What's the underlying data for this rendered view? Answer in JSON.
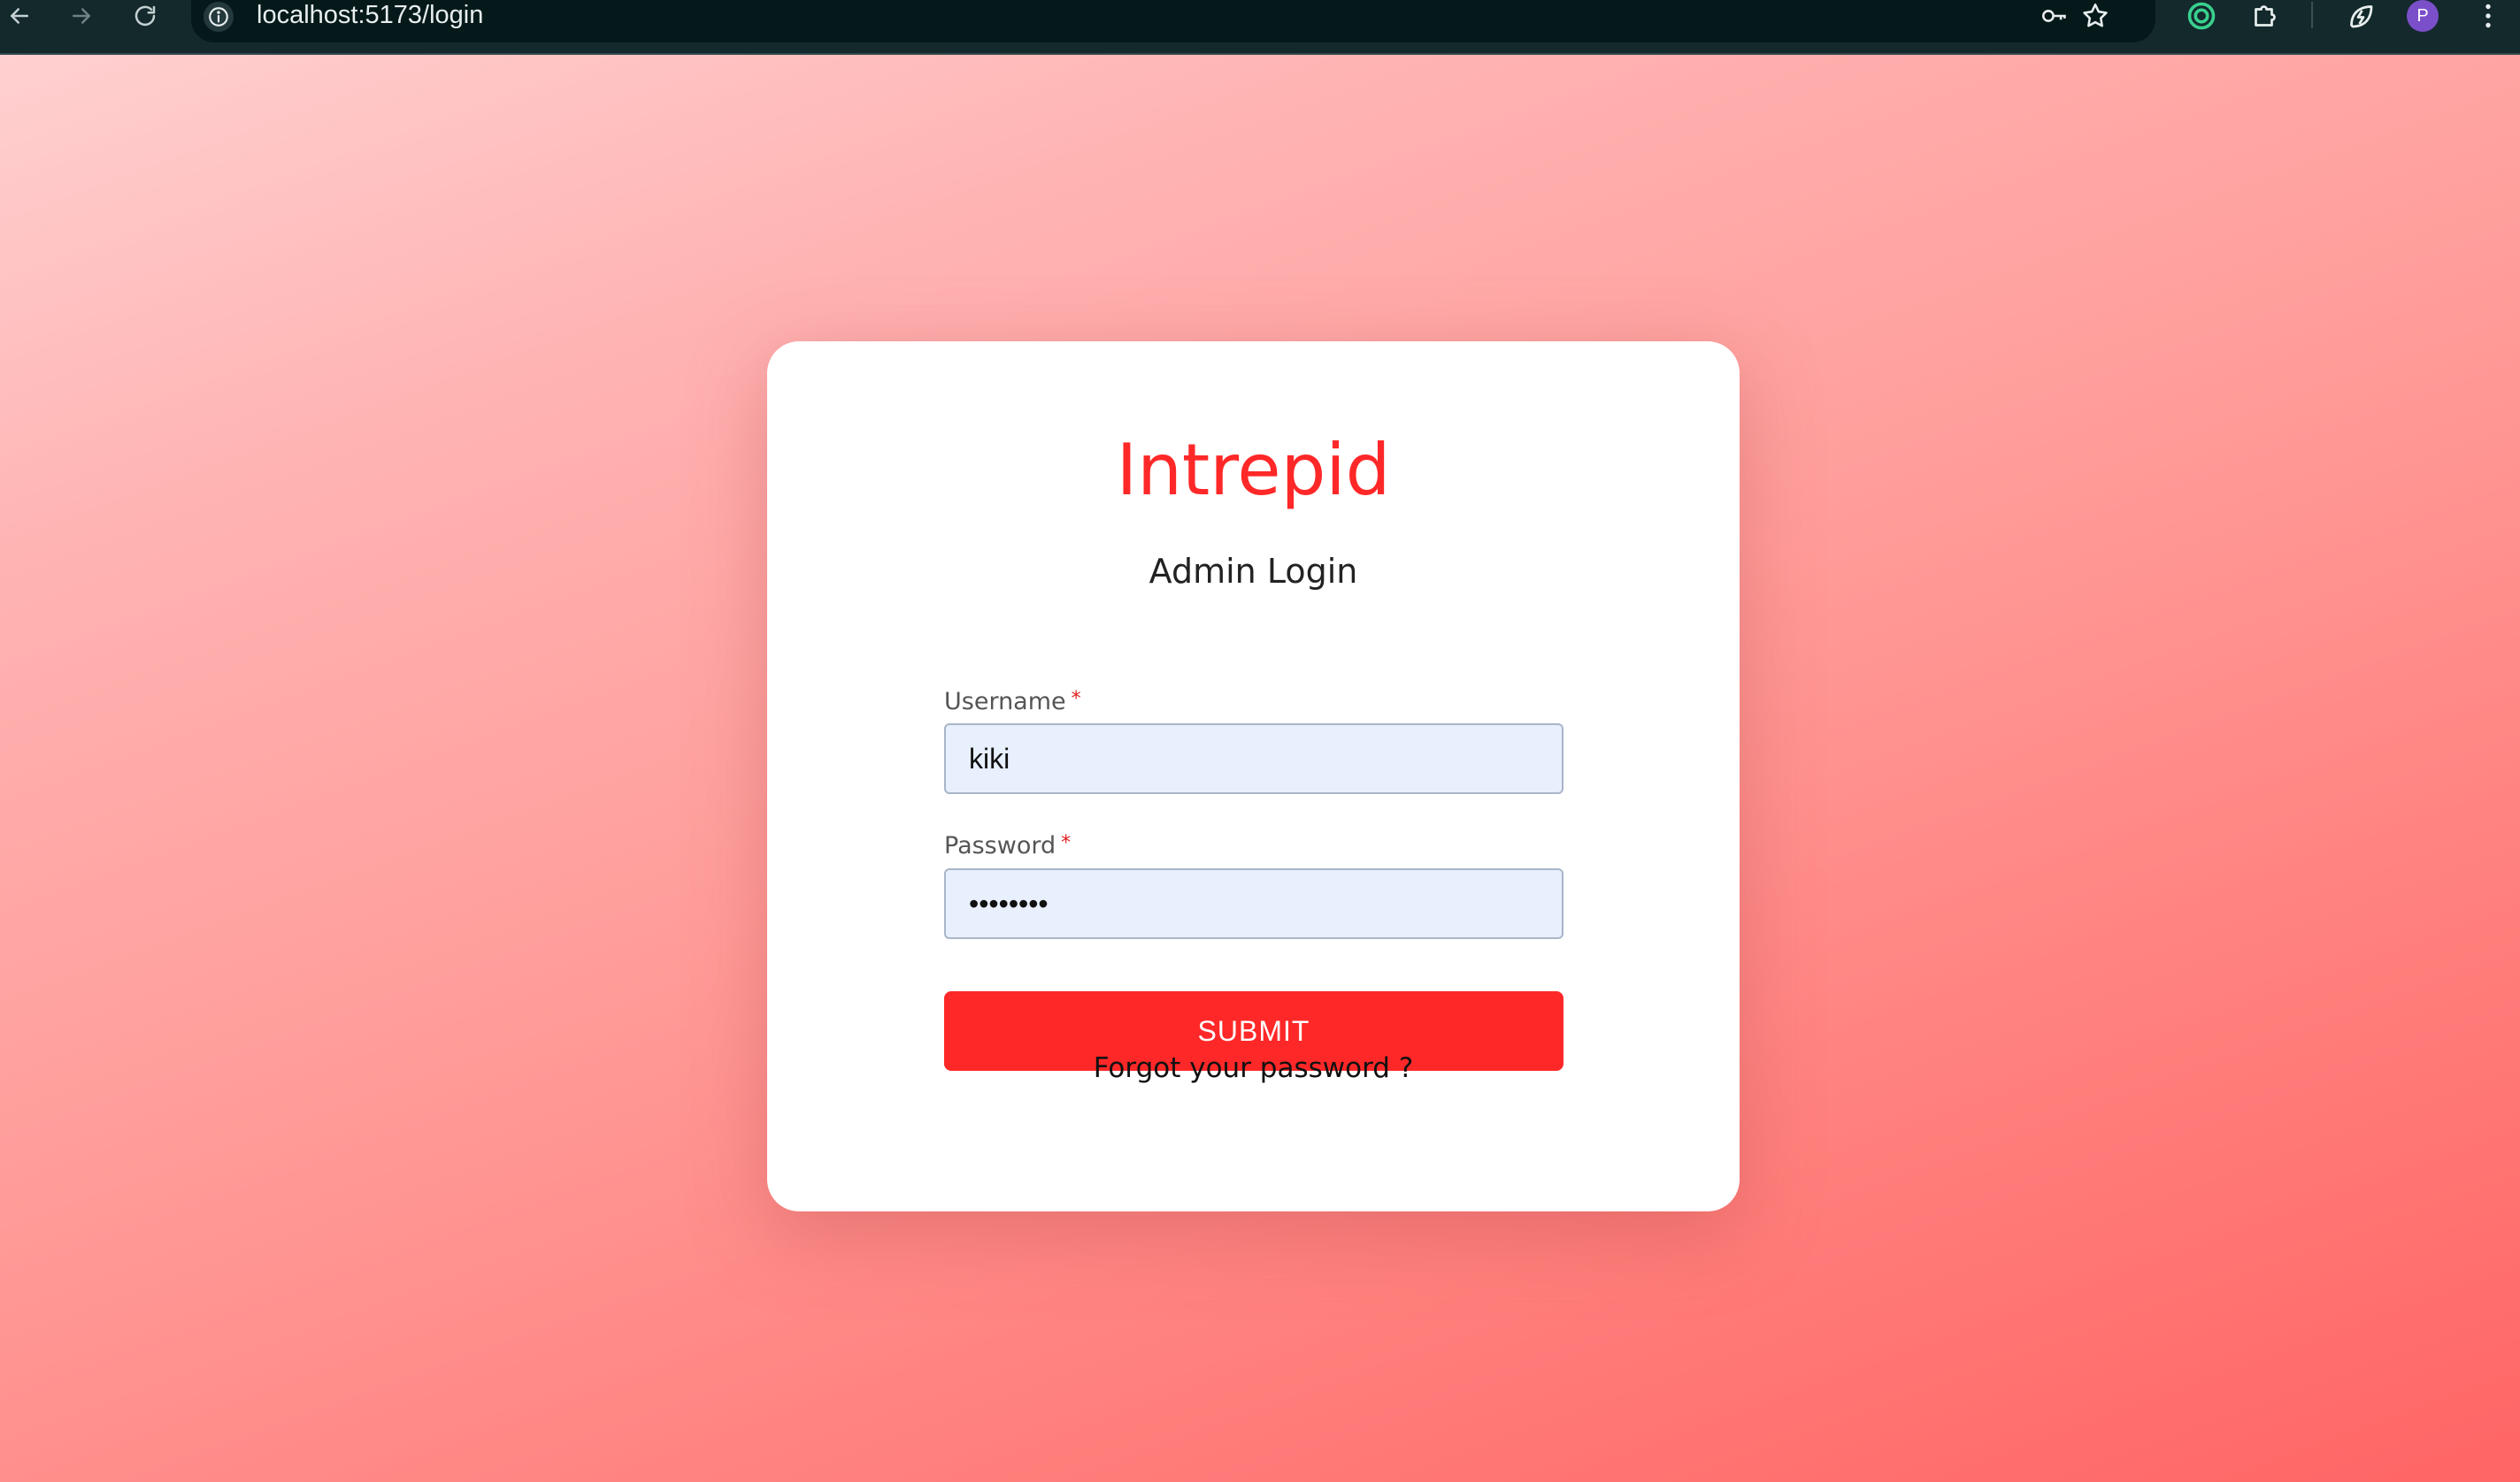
{
  "browser": {
    "url": "localhost:5173/login",
    "profile_initial": "P",
    "icons": {
      "back": "arrow-left-icon",
      "forward": "arrow-right-icon",
      "reload": "reload-icon",
      "site_info": "info-icon",
      "password_manager": "key-icon",
      "bookmark": "star-icon",
      "extension_1": "target-icon",
      "extensions": "puzzle-icon",
      "performance": "leaf-bolt-icon",
      "menu": "kebab-menu-icon"
    }
  },
  "login": {
    "brand": "Intrepid",
    "subtitle": "Admin Login",
    "username_label": "Username",
    "username_required": "*",
    "username_value": "kiki",
    "password_label": "Password",
    "password_required": "*",
    "password_value": "••••••••",
    "submit_label": "SUBMIT",
    "forgot_label": "Forgot your password ?"
  },
  "colors": {
    "accent": "#ff2828",
    "input_bg": "#e8effd",
    "background_start": "#ffd0d0",
    "background_end": "#ff6565"
  }
}
